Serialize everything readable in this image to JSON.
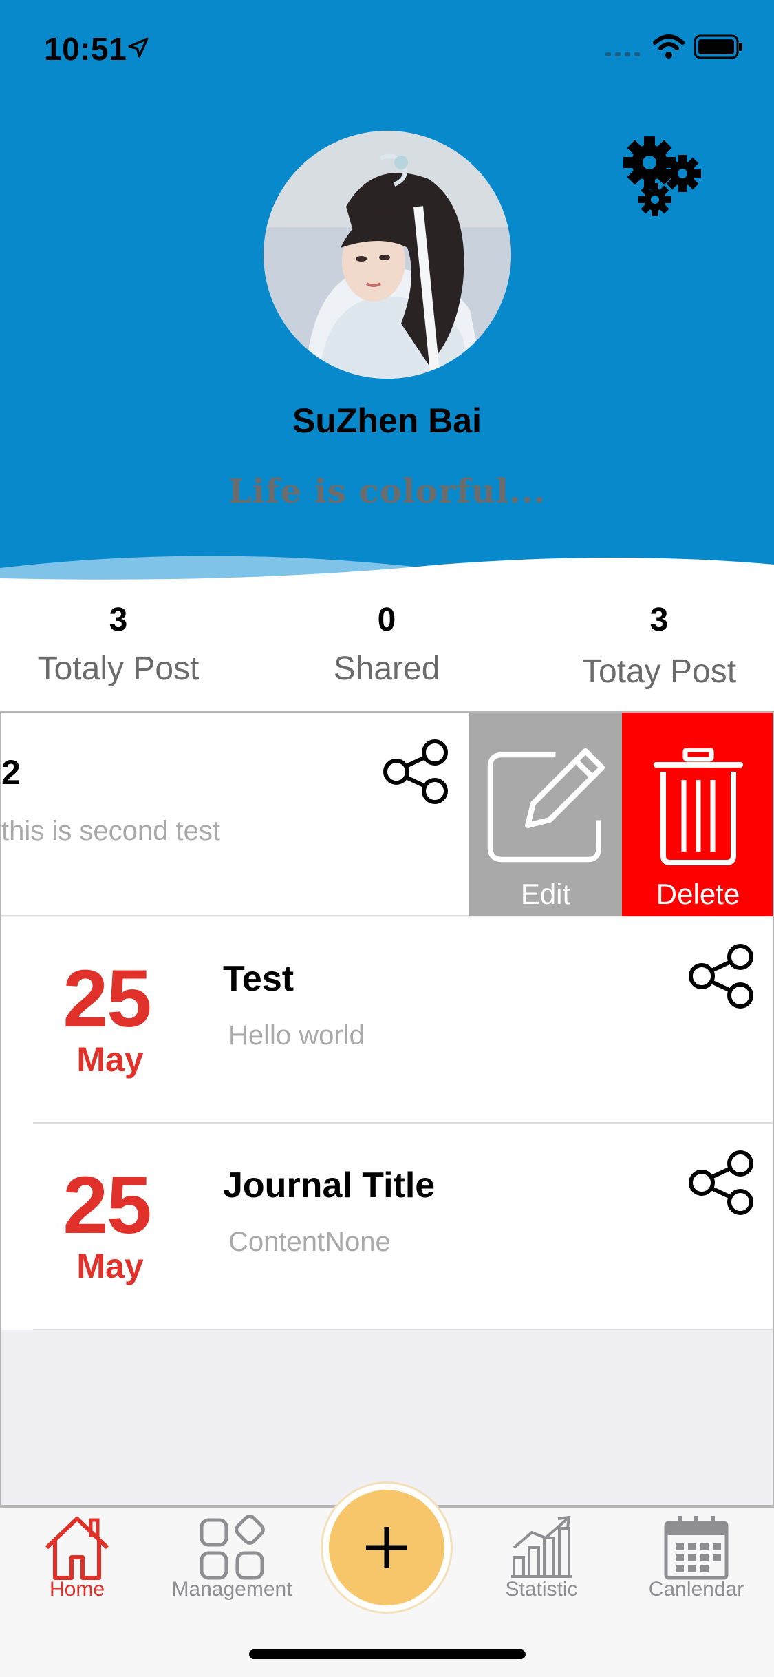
{
  "status_bar": {
    "time": "10:51"
  },
  "profile": {
    "name": "SuZhen Bai",
    "motto": "Life is colorful...",
    "settings_icon": "gears-icon"
  },
  "stats": [
    {
      "value": "3",
      "label": "Totaly Post"
    },
    {
      "value": "0",
      "label": "Shared"
    },
    {
      "value": "3",
      "label": "Totay Post"
    }
  ],
  "journal": {
    "swiped_entry": {
      "title": "2",
      "content": "this is second test",
      "actions": [
        {
          "label": "Edit",
          "icon": "pencil-icon",
          "color": "#a9a9a9"
        },
        {
          "label": "Delete",
          "icon": "trash-icon",
          "color": "#ff0000"
        }
      ]
    },
    "entries": [
      {
        "day": "25",
        "month": "May",
        "title": "Test",
        "content": "Hello world"
      },
      {
        "day": "25",
        "month": "May",
        "title": "Journal Title",
        "content": "ContentNone"
      }
    ]
  },
  "tabbar": {
    "items": [
      {
        "label": "Home",
        "icon": "home-icon",
        "active": true
      },
      {
        "label": "Management",
        "icon": "grid-icon",
        "active": false
      },
      {
        "label": "Statistic",
        "icon": "chart-icon",
        "active": false
      },
      {
        "label": "Canlendar",
        "icon": "calendar-icon",
        "active": false
      }
    ],
    "add_button_icon": "plus-icon"
  },
  "colors": {
    "header_blue": "#0789cc",
    "accent_red": "#e0322a",
    "fab_yellow": "#f8c66a"
  }
}
